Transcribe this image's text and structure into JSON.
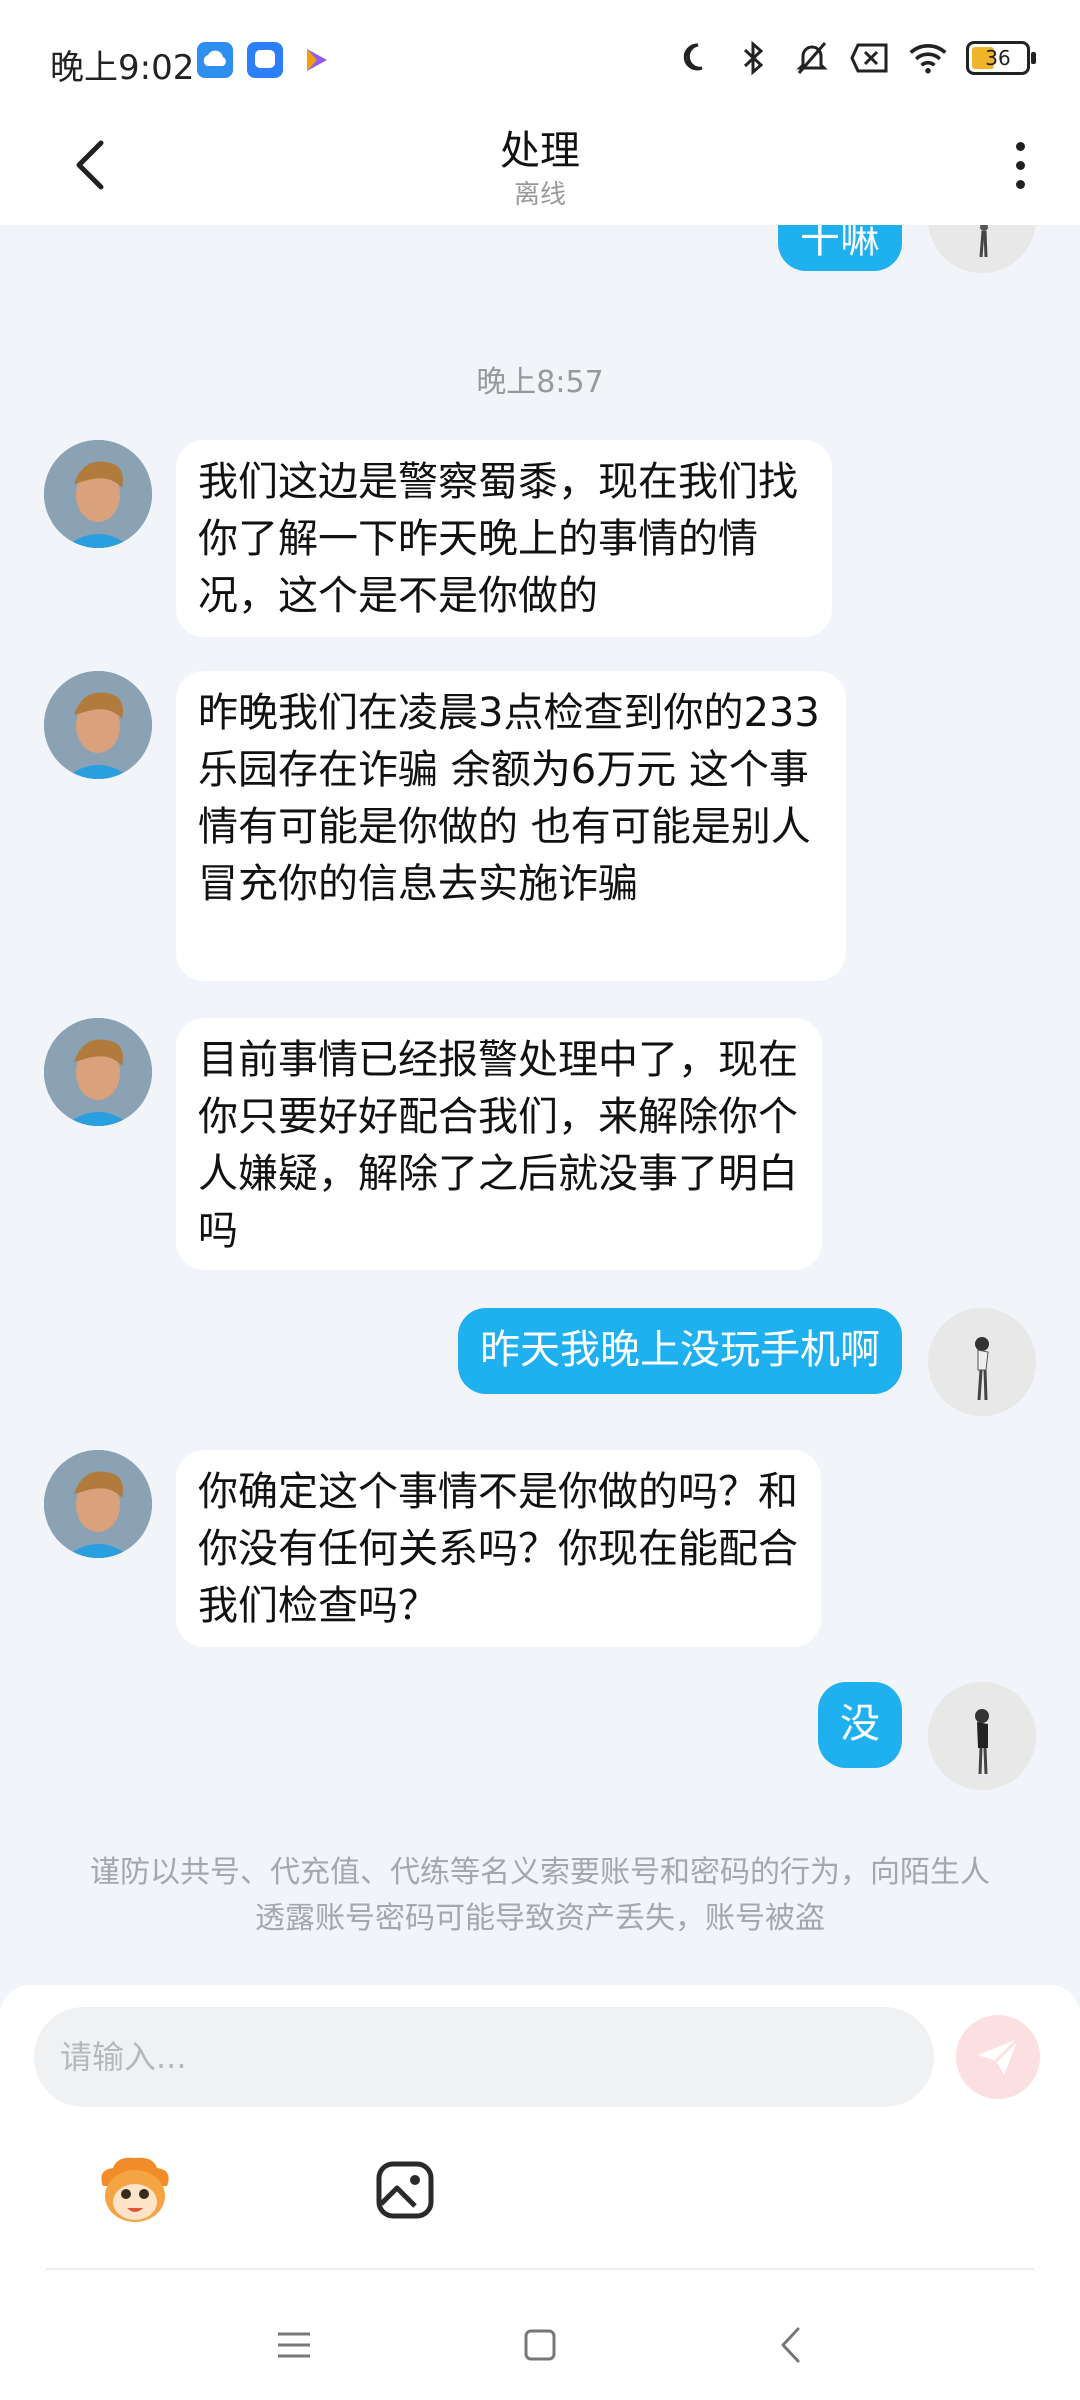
{
  "status_bar": {
    "time": "晚上9:02",
    "battery": "36",
    "icons": [
      "cloud-app-icon",
      "chat-app-icon",
      "play-app-icon",
      "moon-icon",
      "bluetooth-icon",
      "mute-icon",
      "no-sim-icon",
      "wifi-icon",
      "battery-icon"
    ]
  },
  "header": {
    "title": "处理",
    "subtitle": "离线",
    "back_icon": "chevron-left-icon",
    "more_icon": "more-vertical-icon"
  },
  "chat": {
    "partial_top_bubble": "干嘛",
    "timestamp": "晚上8:57",
    "messages": [
      {
        "side": "in",
        "text": "我们这边是警察蜀黍，现在我们找你了解一下昨天晚上的事情的情况，这个是不是你做的"
      },
      {
        "side": "in",
        "text": "昨晚我们在凌晨3点检查到你的233乐园存在诈骗 余额为6万元 这个事情有可能是你做的 也有可能是别人 冒充你的信息去实施诈骗"
      },
      {
        "side": "in",
        "text": "目前事情已经报警处理中了，现在你只要好好配合我们，来解除你个人嫌疑，解除了之后就没事了明白吗"
      },
      {
        "side": "out",
        "text": "昨天我晚上没玩手机啊"
      },
      {
        "side": "in",
        "text": "你确定这个事情不是你做的吗？和你没有任何关系吗？你现在能配合我们检查吗？"
      },
      {
        "side": "out",
        "text": "没"
      }
    ],
    "notice": "谨防以共号、代充值、代练等名义索要账号和密码的行为，向陌生人透露账号密码可能导致资产丢失，账号被盗"
  },
  "input": {
    "placeholder": "请输入...",
    "send_icon": "send-icon",
    "tools": [
      "emoji-mascot-icon",
      "image-icon"
    ]
  },
  "nav": [
    "menu-icon",
    "home-icon",
    "back-icon"
  ],
  "colors": {
    "accent": "#1fb0ef",
    "background": "#f1f4f8",
    "send_disabled": "#fcdfe0"
  }
}
